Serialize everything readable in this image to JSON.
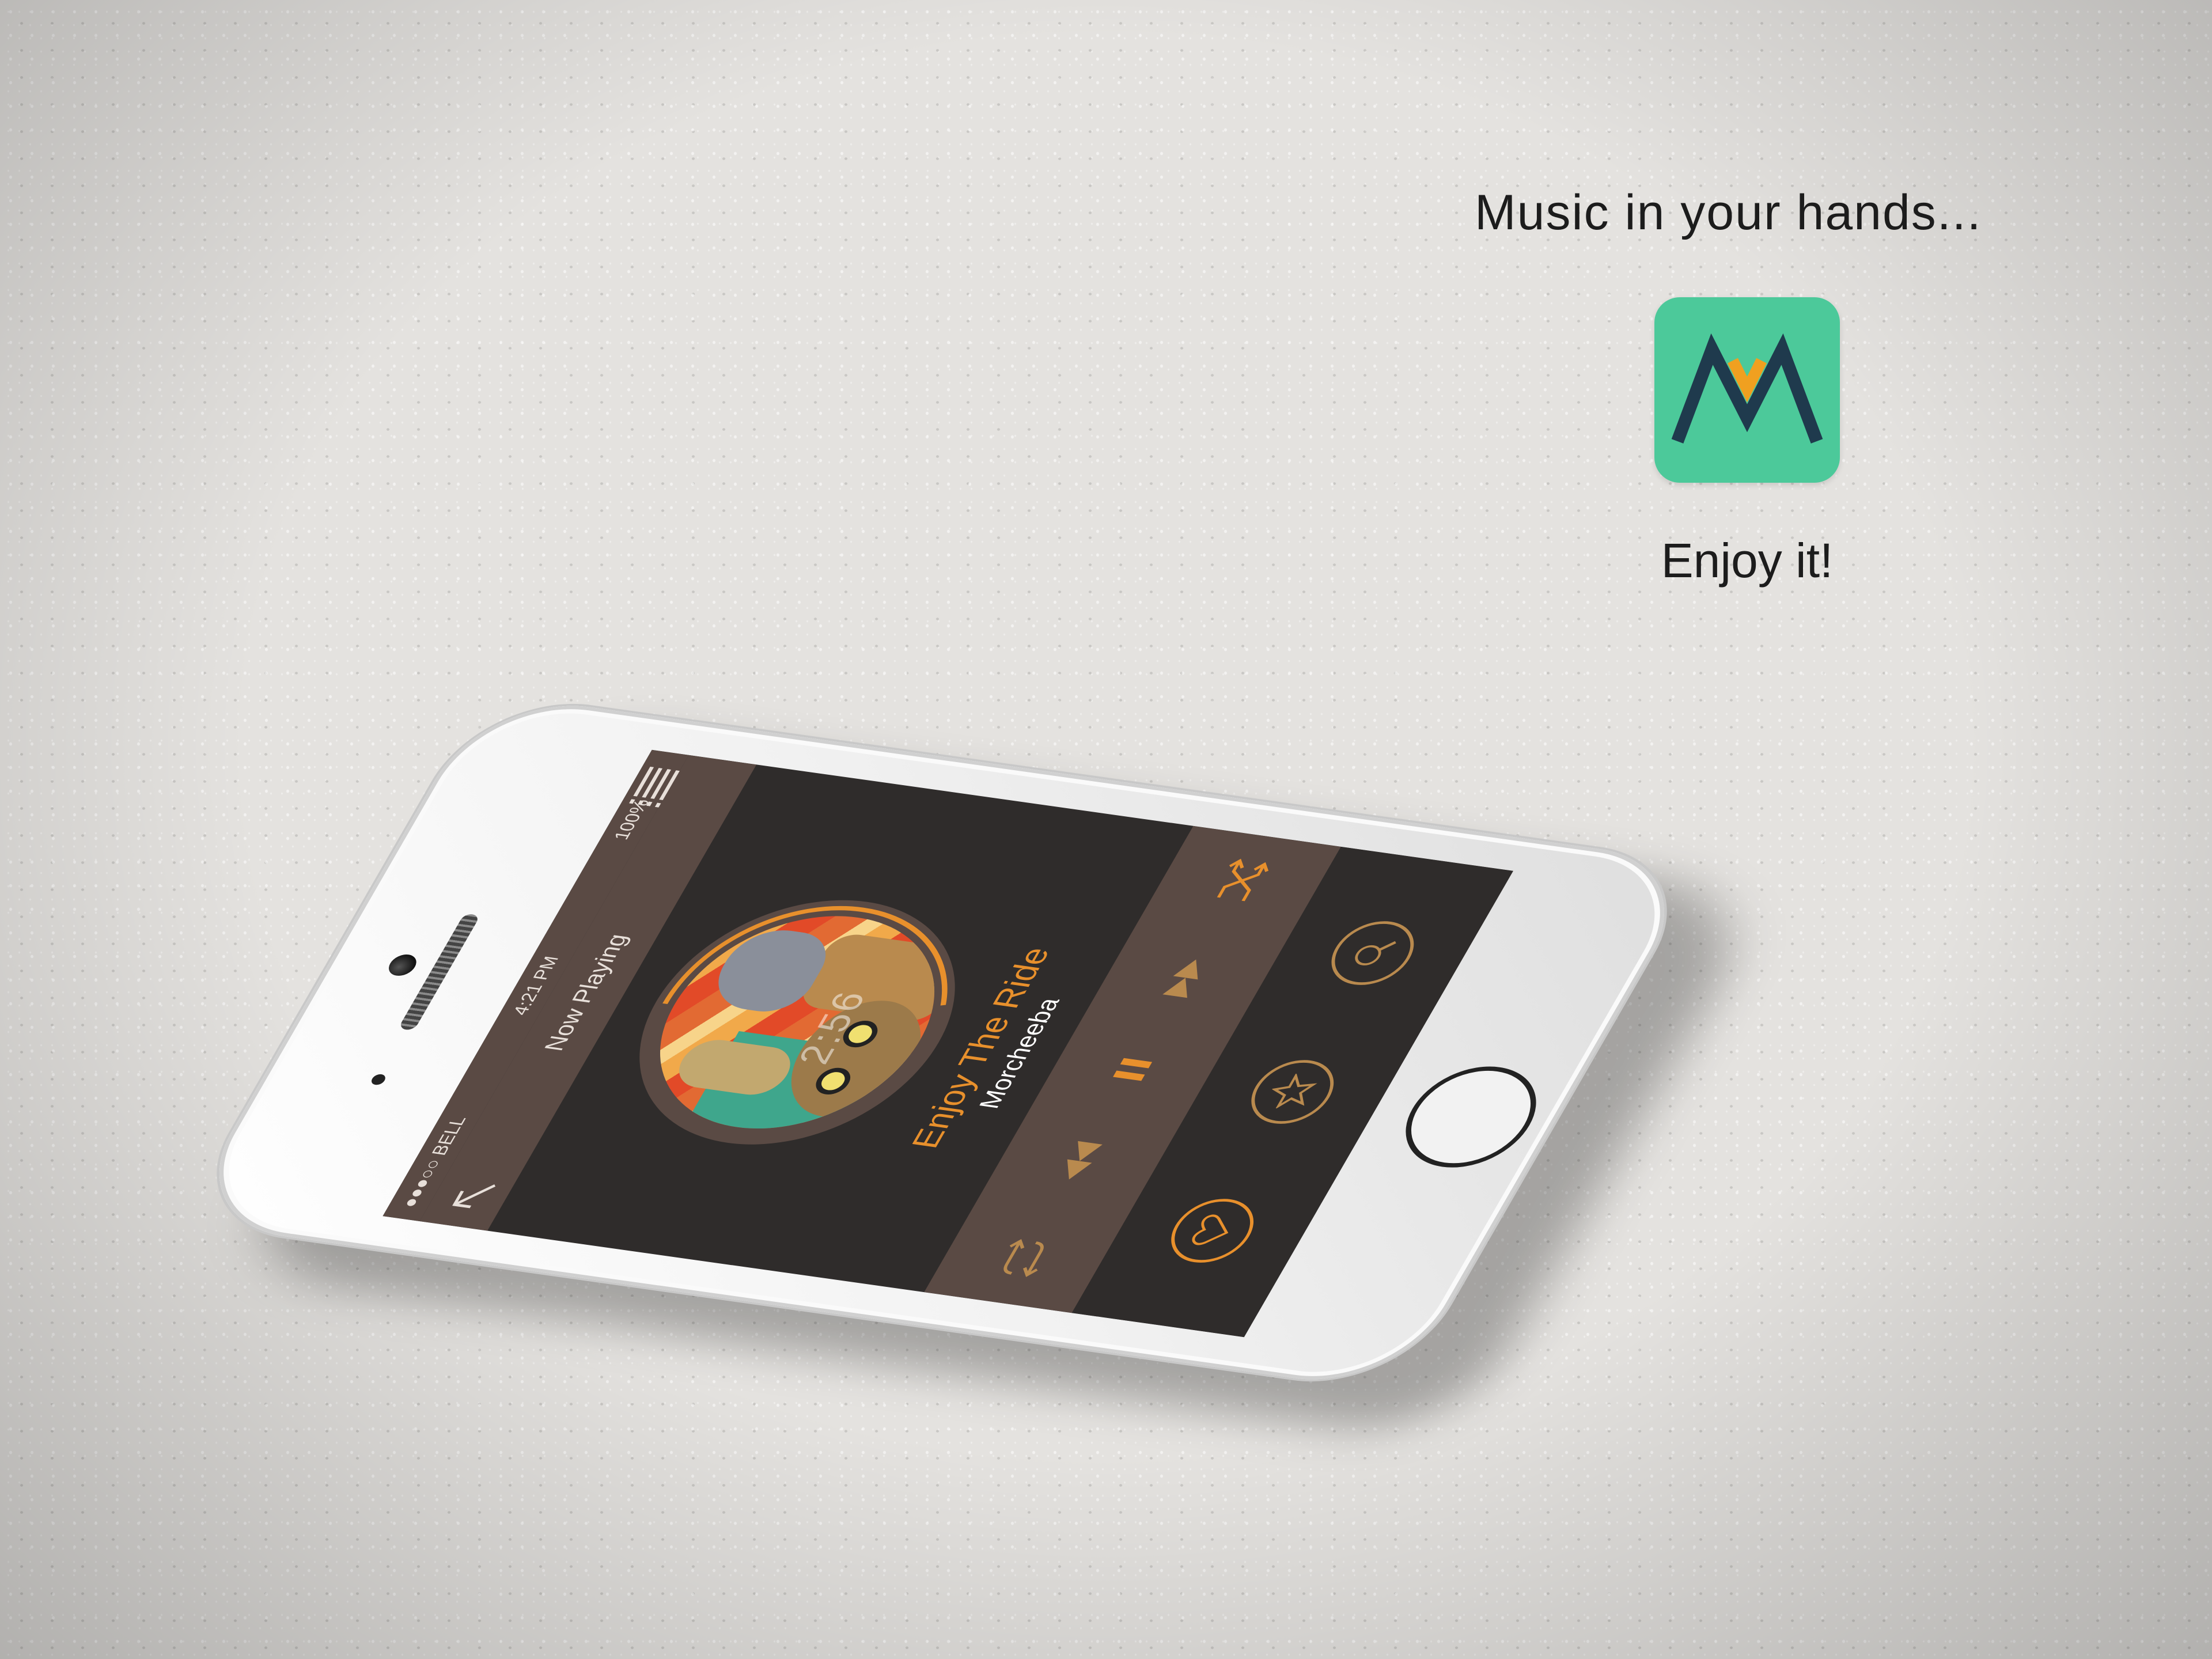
{
  "promo": {
    "tagline": "Music in your hands...",
    "enjoy": "Enjoy it!",
    "icon_colors": {
      "background": "#4cc99a",
      "stroke": "#1f3a4d",
      "accent": "#f0a020"
    }
  },
  "status_bar": {
    "carrier": "●●●○○ BELL",
    "time": "4:21 PM",
    "battery": "100%"
  },
  "nav": {
    "title": "Now Playing"
  },
  "player": {
    "elapsed": "2:56",
    "progress_fraction": 0.45,
    "song_title": "Enjoy The Ride",
    "artist": "Morcheeba"
  },
  "colors": {
    "accent": "#e8902c",
    "bar": "#5a4a44",
    "screen_bg": "#2f2c2b",
    "icon_muted": "#b98a4e"
  },
  "icons": {
    "back": "back-arrow-icon",
    "list": "playlist-icon",
    "repeat": "repeat-icon",
    "rewind": "rewind-icon",
    "pause": "pause-icon",
    "forward": "fast-forward-icon",
    "shuffle": "shuffle-icon",
    "like": "heart-icon",
    "favorite": "star-icon",
    "search": "search-icon"
  }
}
